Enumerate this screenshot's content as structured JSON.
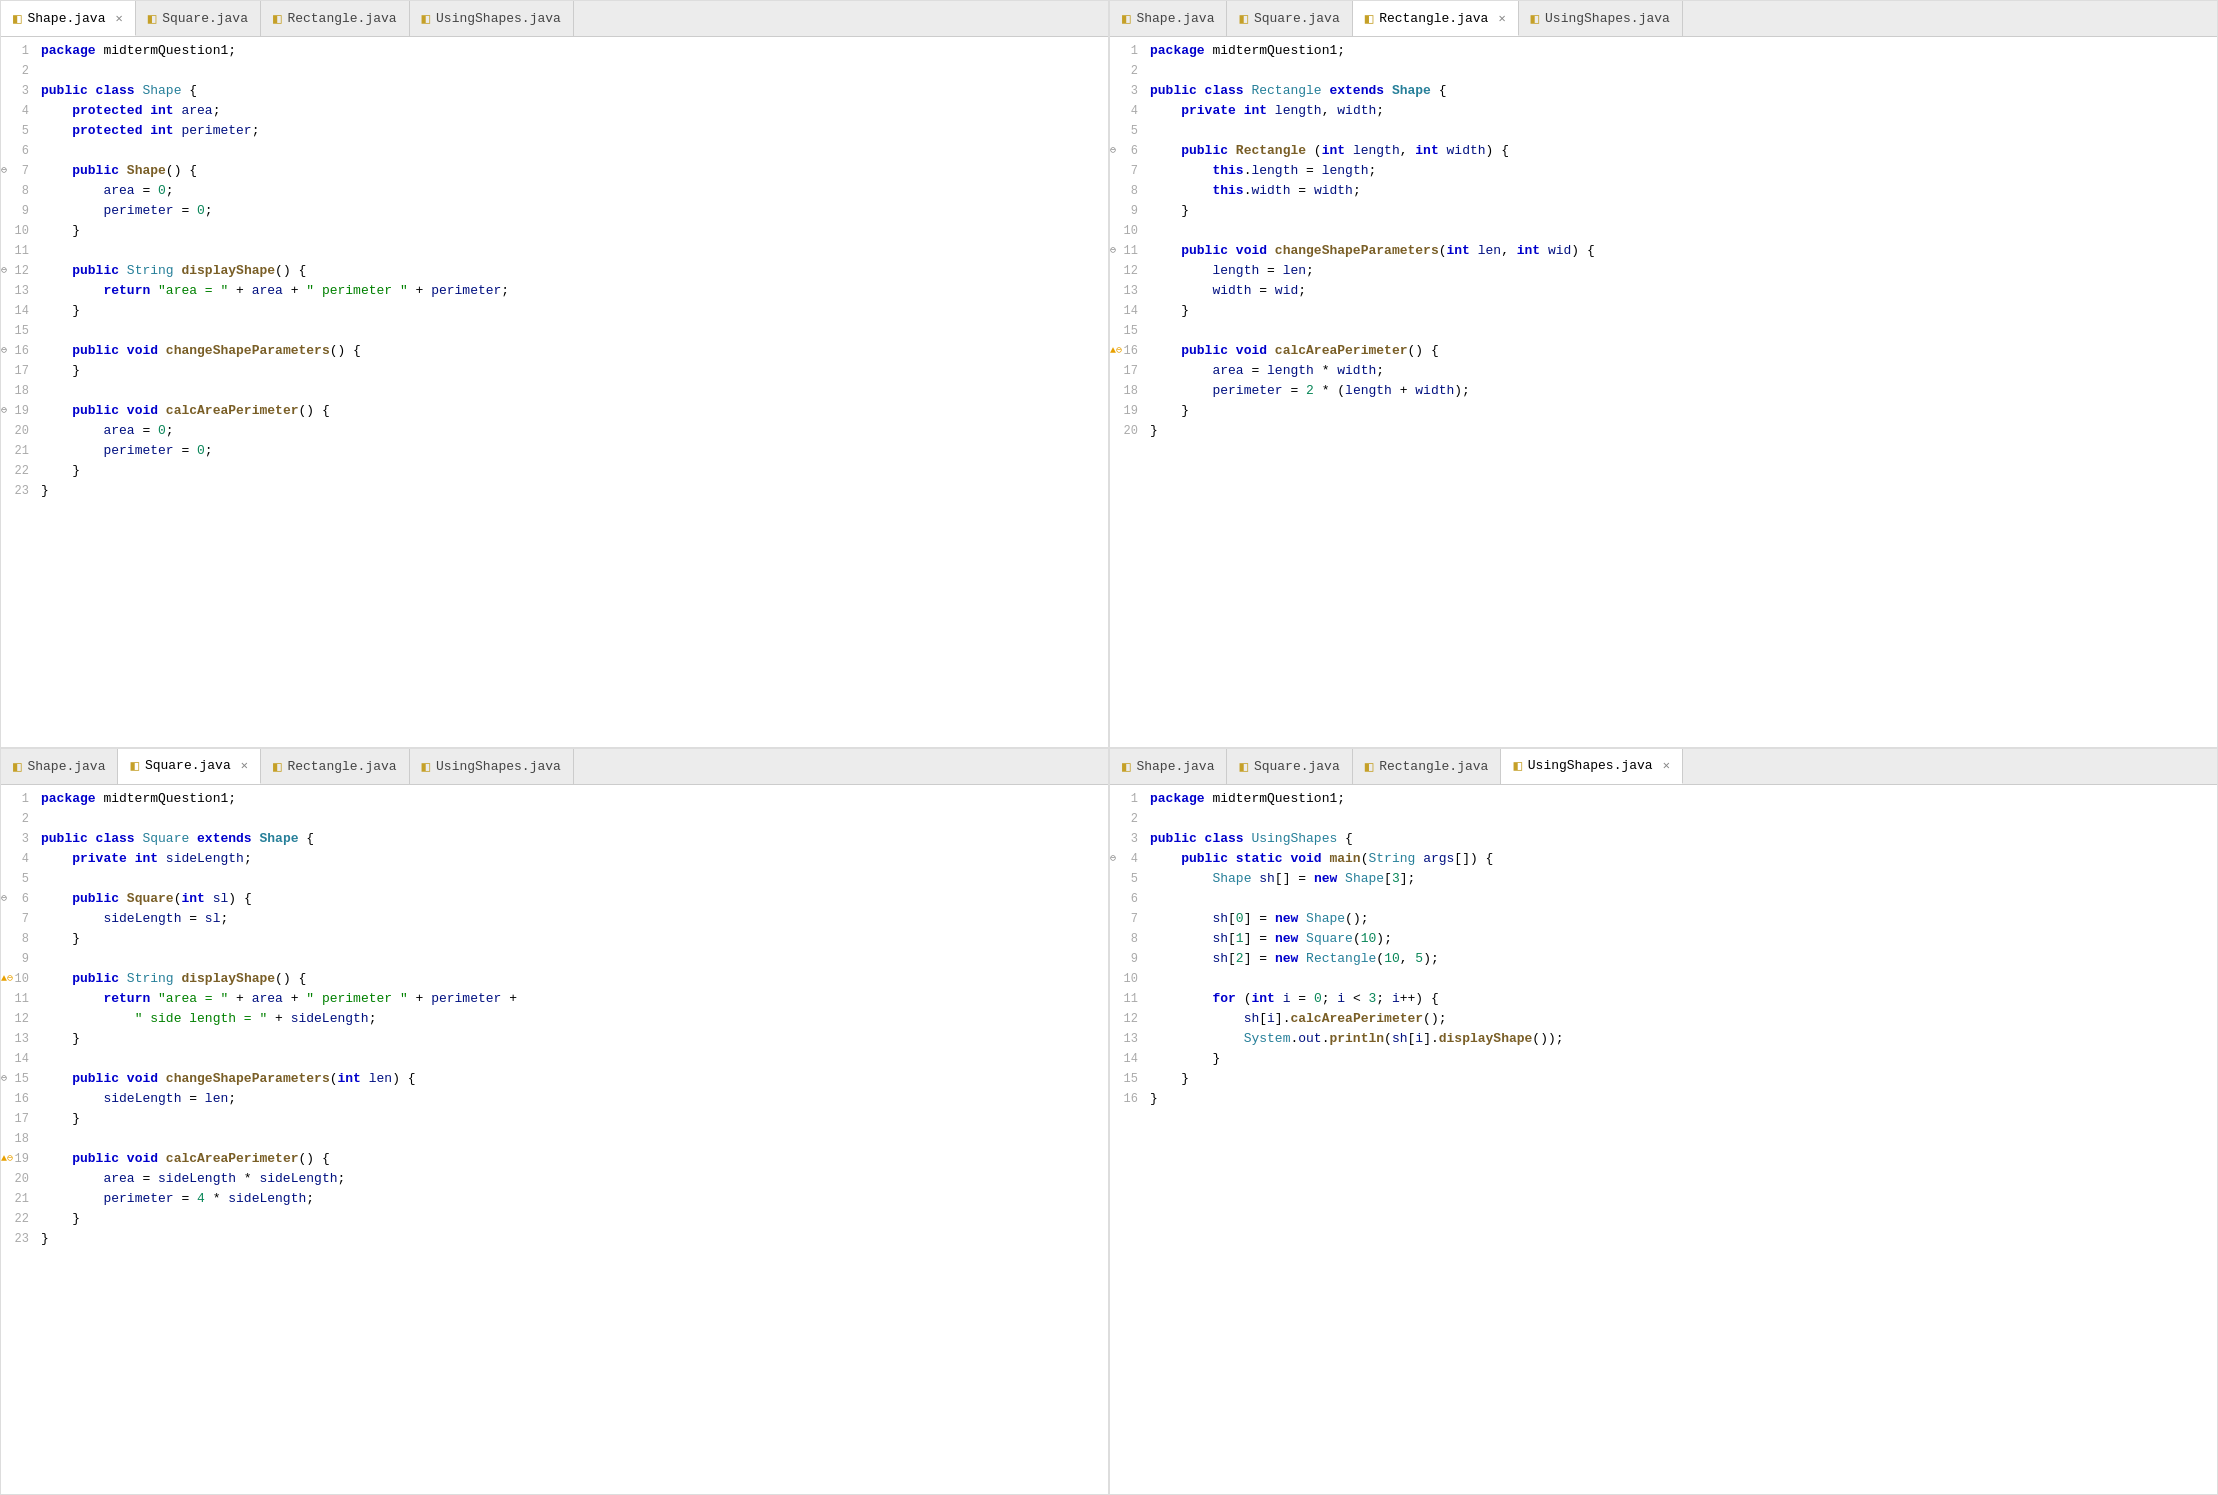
{
  "panels": [
    {
      "id": "shape-panel",
      "tabs": [
        {
          "label": "Shape.java",
          "active": true,
          "close": true
        },
        {
          "label": "Square.java",
          "active": false,
          "close": false
        },
        {
          "label": "Rectangle.java",
          "active": false,
          "close": false
        },
        {
          "label": "UsingShapes.java",
          "active": false,
          "close": false
        }
      ],
      "file": "Shape.java"
    },
    {
      "id": "rectangle-panel",
      "tabs": [
        {
          "label": "Shape.java",
          "active": false,
          "close": false
        },
        {
          "label": "Square.java",
          "active": false,
          "close": false
        },
        {
          "label": "Rectangle.java",
          "active": true,
          "close": true
        },
        {
          "label": "UsingShapes.java",
          "active": false,
          "close": false
        }
      ],
      "file": "Rectangle.java"
    },
    {
      "id": "square-panel",
      "tabs": [
        {
          "label": "Shape.java",
          "active": false,
          "close": false
        },
        {
          "label": "Square.java",
          "active": true,
          "close": true
        },
        {
          "label": "Rectangle.java",
          "active": false,
          "close": false
        },
        {
          "label": "UsingShapes.java",
          "active": false,
          "close": false
        }
      ],
      "file": "Square.java"
    },
    {
      "id": "usingshapes-panel",
      "tabs": [
        {
          "label": "Shape.java",
          "active": false,
          "close": false
        },
        {
          "label": "Square.java",
          "active": false,
          "close": false
        },
        {
          "label": "Rectangle.java",
          "active": false,
          "close": false
        },
        {
          "label": "UsingShapes.java",
          "active": true,
          "close": true
        }
      ],
      "file": "UsingShapes.java"
    }
  ]
}
